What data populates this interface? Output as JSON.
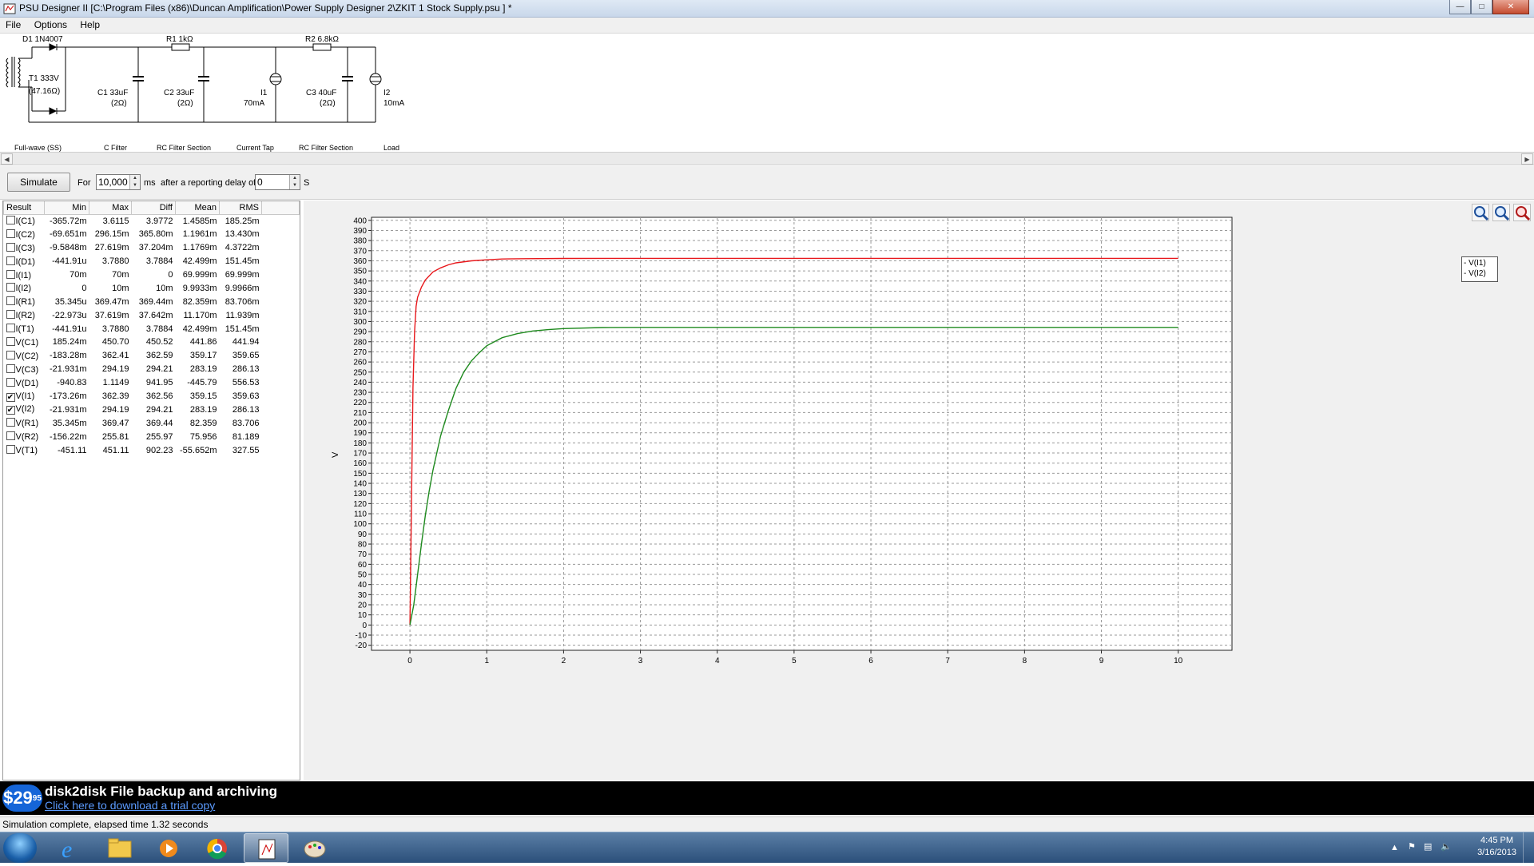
{
  "window": {
    "title": "PSU Designer II  [C:\\Program Files (x86)\\Duncan Amplification\\Power Supply Designer 2\\ZKIT 1 Stock Supply.psu ] *",
    "minimize": "—",
    "maximize": "□",
    "close": "✕"
  },
  "menu": [
    "File",
    "Options",
    "Help"
  ],
  "schematic": {
    "d1": "D1 1N4007",
    "t1_a": "T1 333V",
    "t1_b": "(47.16Ω)",
    "r1": "R1 1kΩ",
    "r2": "R2 6.8kΩ",
    "c1_a": "C1 33uF",
    "c1_b": "(2Ω)",
    "c2_a": "C2 33uF",
    "c2_b": "(2Ω)",
    "i1_a": "I1",
    "i1_b": "70mA",
    "c3_a": "C3 40uF",
    "c3_b": "(2Ω)",
    "i2_a": "I2",
    "i2_b": "10mA",
    "sections": [
      "Full-wave (SS)",
      "C Filter",
      "RC Filter Section",
      "Current Tap",
      "RC Filter Section",
      "Load"
    ]
  },
  "toolbar": {
    "simulate": "Simulate",
    "for": "For",
    "duration": "10,000",
    "ms": "ms",
    "delay_label": "after a reporting delay of",
    "delay": "0",
    "s": "S"
  },
  "results": {
    "headers": [
      "Result",
      "Min",
      "Max",
      "Diff",
      "Mean",
      "RMS"
    ],
    "rows": [
      {
        "name": "I(C1)",
        "checked": false,
        "cells": [
          "-365.72m",
          "3.6115",
          "3.9772",
          "1.4585m",
          "185.25m"
        ]
      },
      {
        "name": "I(C2)",
        "checked": false,
        "cells": [
          "-69.651m",
          "296.15m",
          "365.80m",
          "1.1961m",
          "13.430m"
        ]
      },
      {
        "name": "I(C3)",
        "checked": false,
        "cells": [
          "-9.5848m",
          "27.619m",
          "37.204m",
          "1.1769m",
          "4.3722m"
        ]
      },
      {
        "name": "I(D1)",
        "checked": false,
        "cells": [
          "-441.91u",
          "3.7880",
          "3.7884",
          "42.499m",
          "151.45m"
        ]
      },
      {
        "name": "I(I1)",
        "checked": false,
        "cells": [
          "70m",
          "70m",
          "0",
          "69.999m",
          "69.999m"
        ]
      },
      {
        "name": "I(I2)",
        "checked": false,
        "cells": [
          "0",
          "10m",
          "10m",
          "9.9933m",
          "9.9966m"
        ]
      },
      {
        "name": "I(R1)",
        "checked": false,
        "cells": [
          "35.345u",
          "369.47m",
          "369.44m",
          "82.359m",
          "83.706m"
        ]
      },
      {
        "name": "I(R2)",
        "checked": false,
        "cells": [
          "-22.973u",
          "37.619m",
          "37.642m",
          "11.170m",
          "11.939m"
        ]
      },
      {
        "name": "I(T1)",
        "checked": false,
        "cells": [
          "-441.91u",
          "3.7880",
          "3.7884",
          "42.499m",
          "151.45m"
        ]
      },
      {
        "name": "V(C1)",
        "checked": false,
        "cells": [
          "185.24m",
          "450.70",
          "450.52",
          "441.86",
          "441.94"
        ]
      },
      {
        "name": "V(C2)",
        "checked": false,
        "cells": [
          "-183.28m",
          "362.41",
          "362.59",
          "359.17",
          "359.65"
        ]
      },
      {
        "name": "V(C3)",
        "checked": false,
        "cells": [
          "-21.931m",
          "294.19",
          "294.21",
          "283.19",
          "286.13"
        ]
      },
      {
        "name": "V(D1)",
        "checked": false,
        "cells": [
          "-940.83",
          "1.1149",
          "941.95",
          "-445.79",
          "556.53"
        ]
      },
      {
        "name": "V(I1)",
        "checked": true,
        "cells": [
          "-173.26m",
          "362.39",
          "362.56",
          "359.15",
          "359.63"
        ]
      },
      {
        "name": "V(I2)",
        "checked": true,
        "cells": [
          "-21.931m",
          "294.19",
          "294.21",
          "283.19",
          "286.13"
        ]
      },
      {
        "name": "V(R1)",
        "checked": false,
        "cells": [
          "35.345m",
          "369.47",
          "369.44",
          "82.359",
          "83.706"
        ]
      },
      {
        "name": "V(R2)",
        "checked": false,
        "cells": [
          "-156.22m",
          "255.81",
          "255.97",
          "75.956",
          "81.189"
        ]
      },
      {
        "name": "V(T1)",
        "checked": false,
        "cells": [
          "-451.11",
          "451.11",
          "902.23",
          "-55.652m",
          "327.55"
        ]
      }
    ]
  },
  "chart_data": {
    "type": "line",
    "ylabel": "V",
    "xlabel": "",
    "xlim": [
      -0.5,
      10.7
    ],
    "ylim": [
      -25,
      403
    ],
    "xticks": [
      0,
      1,
      2,
      3,
      4,
      5,
      6,
      7,
      8,
      9,
      10
    ],
    "yticks": [
      -20,
      -10,
      0,
      10,
      20,
      30,
      40,
      50,
      60,
      70,
      80,
      90,
      100,
      110,
      120,
      130,
      140,
      150,
      160,
      170,
      180,
      190,
      200,
      210,
      220,
      230,
      240,
      250,
      260,
      270,
      280,
      290,
      300,
      310,
      320,
      330,
      340,
      350,
      360,
      370,
      380,
      390,
      400
    ],
    "grid": true,
    "legend": "right",
    "series": [
      {
        "name": "V(I1)",
        "color": "#e8171b",
        "x": [
          0,
          0.02,
          0.04,
          0.06,
          0.08,
          0.1,
          0.15,
          0.2,
          0.3,
          0.4,
          0.5,
          0.6,
          0.8,
          1.0,
          1.2,
          1.5,
          2.0,
          3.0,
          5.0,
          7.0,
          10.0
        ],
        "y": [
          0,
          120,
          235,
          290,
          315,
          324,
          334,
          341,
          349,
          353,
          356,
          358,
          360,
          361,
          361.8,
          362.1,
          362.3,
          362.4,
          362.4,
          362.4,
          362.4
        ]
      },
      {
        "name": "V(I2)",
        "color": "#1e8a1e",
        "x": [
          0,
          0.05,
          0.1,
          0.15,
          0.2,
          0.25,
          0.3,
          0.4,
          0.5,
          0.6,
          0.7,
          0.8,
          0.9,
          1.0,
          1.2,
          1.4,
          1.6,
          1.8,
          2.0,
          2.5,
          3.0,
          5.0,
          10.0
        ],
        "y": [
          0,
          20,
          50,
          80,
          108,
          132,
          153,
          187,
          212,
          234,
          250,
          261,
          269,
          276,
          284,
          288,
          290.6,
          292,
          293,
          294,
          294.2,
          294.2,
          294.2
        ]
      }
    ]
  },
  "ad": {
    "price": "$29",
    "price_cents": "95",
    "headline": "disk2disk File backup and archiving",
    "link": "Click here to download a trial copy"
  },
  "status": "Simulation complete, elapsed time 1.32 seconds",
  "clock": {
    "time": "4:45 PM",
    "date": "3/16/2013"
  }
}
